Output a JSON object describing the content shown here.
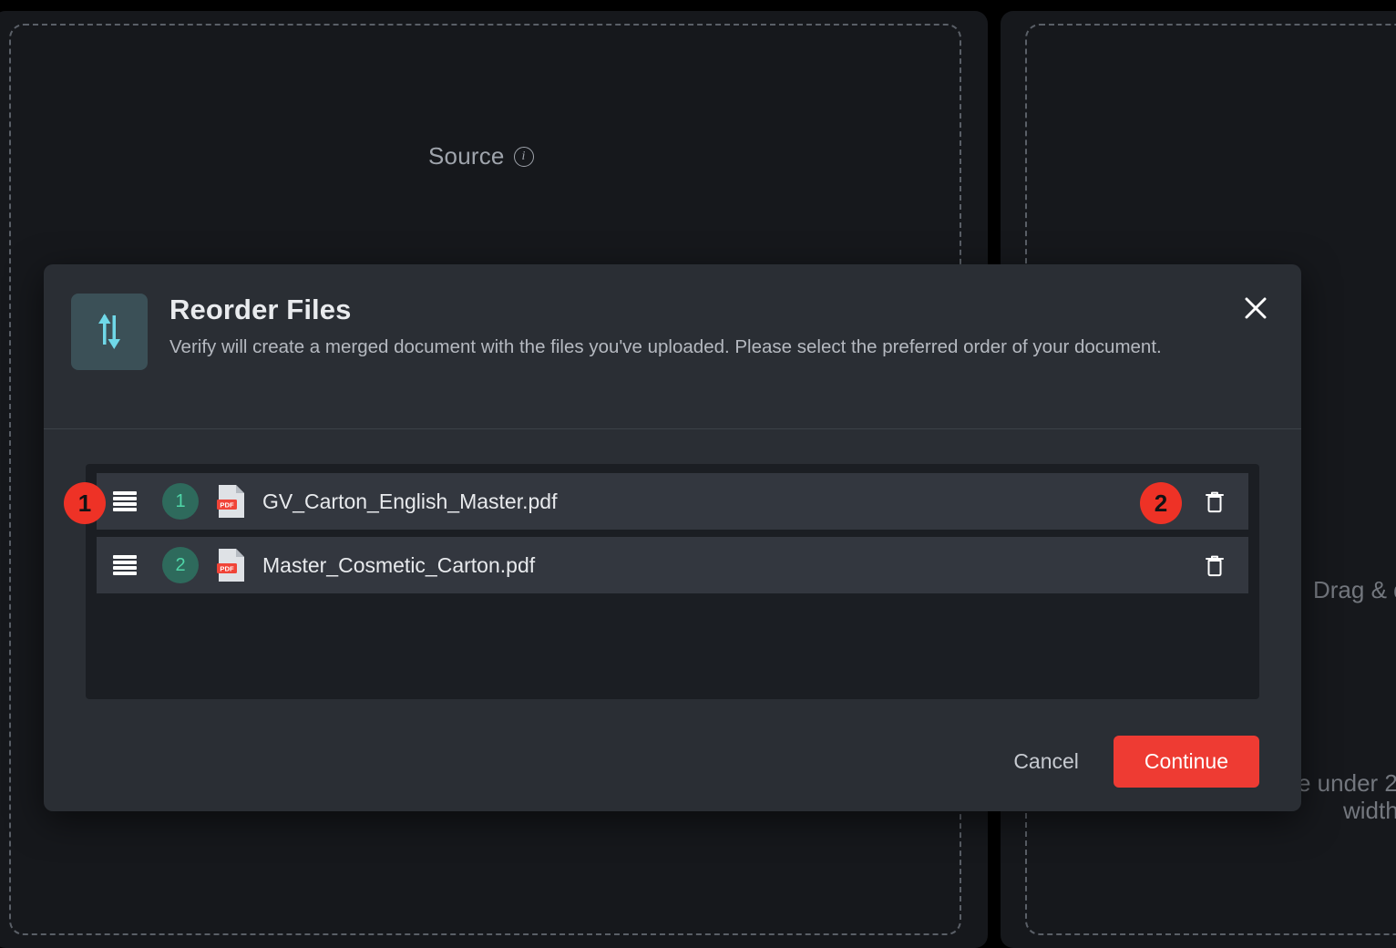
{
  "background": {
    "source_label": "Source",
    "info_icon": "info-circle-icon",
    "drag_text": "Drag & d",
    "size_text": "e under 2",
    "width_text": "width"
  },
  "dialog": {
    "icon": "sort-arrows-icon",
    "title": "Reorder Files",
    "description": "Verify will create a merged document with the files you've uploaded. Please select the preferred order of your document.",
    "close_icon": "close-icon",
    "files": [
      {
        "order": "1",
        "name": "GV_Carton_English_Master.pdf",
        "type_label": "PDF",
        "drag_icon": "drag-handle-icon",
        "delete_icon": "trash-icon"
      },
      {
        "order": "2",
        "name": "Master_Cosmetic_Carton.pdf",
        "type_label": "PDF",
        "drag_icon": "drag-handle-icon",
        "delete_icon": "trash-icon"
      }
    ],
    "cancel_label": "Cancel",
    "continue_label": "Continue"
  },
  "annotations": [
    {
      "label": "1"
    },
    {
      "label": "2"
    }
  ],
  "colors": {
    "accent_red": "#ee3b33",
    "badge_teal": "#2e6a5c",
    "badge_text": "#4fd6a8",
    "dialog_bg": "#2a2e34",
    "row_bg": "#33373f",
    "list_bg": "#1b1e23"
  }
}
